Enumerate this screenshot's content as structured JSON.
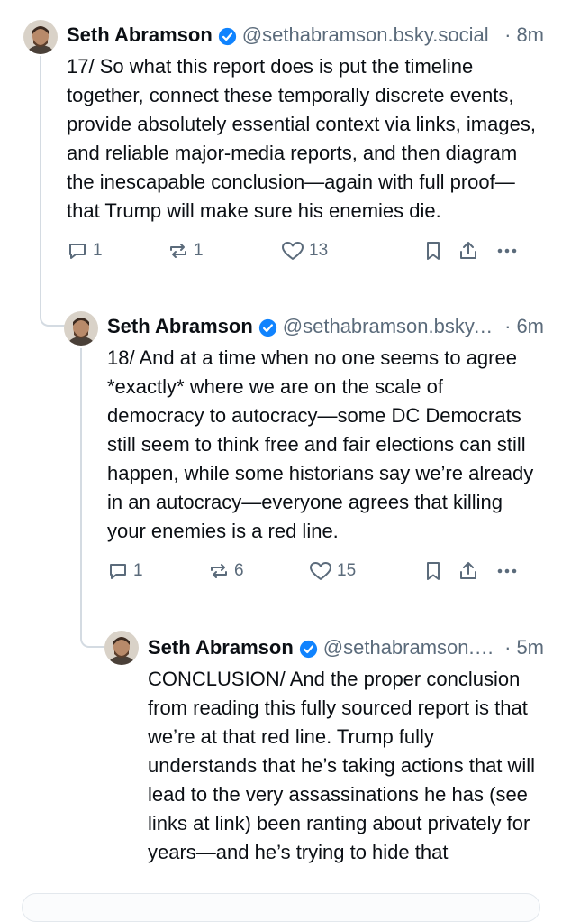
{
  "posts": [
    {
      "author_name": "Seth Abramson",
      "handle": "@sethabramson.bsky.social",
      "timestamp": "8m",
      "separator": "·",
      "text": "17/ So what this report does is put the timeline together, connect these temporally discrete events, provide absolutely essential context via links, images, and reliable major-media reports, and then diagram the inescapable conclusion—again with full proof—that Trump will make sure his enemies die.",
      "replies": "1",
      "reposts": "1",
      "likes": "13"
    },
    {
      "author_name": "Seth Abramson",
      "handle": "@sethabramson.bsky.social",
      "timestamp": "6m",
      "separator": "·",
      "text": "18/ And at a time when no one seems to agree *exactly* where we are on the scale of democracy to autocracy—some DC Democrats still seem to think free and fair elections can still happen, while some historians say we’re already in an autocracy—everyone agrees that killing your enemies is a red line.",
      "replies": "1",
      "reposts": "6",
      "likes": "15"
    },
    {
      "author_name": "Seth Abramson",
      "handle": "@sethabramson.bsky.social",
      "timestamp": "5m",
      "separator": "·",
      "text": "CONCLUSION/ And the proper conclusion from reading this fully sourced report is that we’re at that red line. Trump fully understands that he’s taking actions that will lead to the very assassinations he has (see links at link) been ranting about privately for years—and he’s trying to hide that"
    }
  ],
  "colors": {
    "verified": "#1083fe",
    "muted": "#5b6b7b",
    "thread_line": "#d4dbe2"
  },
  "icons": [
    "reply-icon",
    "repost-icon",
    "like-icon",
    "bookmark-icon",
    "share-icon",
    "more-icon",
    "verified-icon"
  ]
}
